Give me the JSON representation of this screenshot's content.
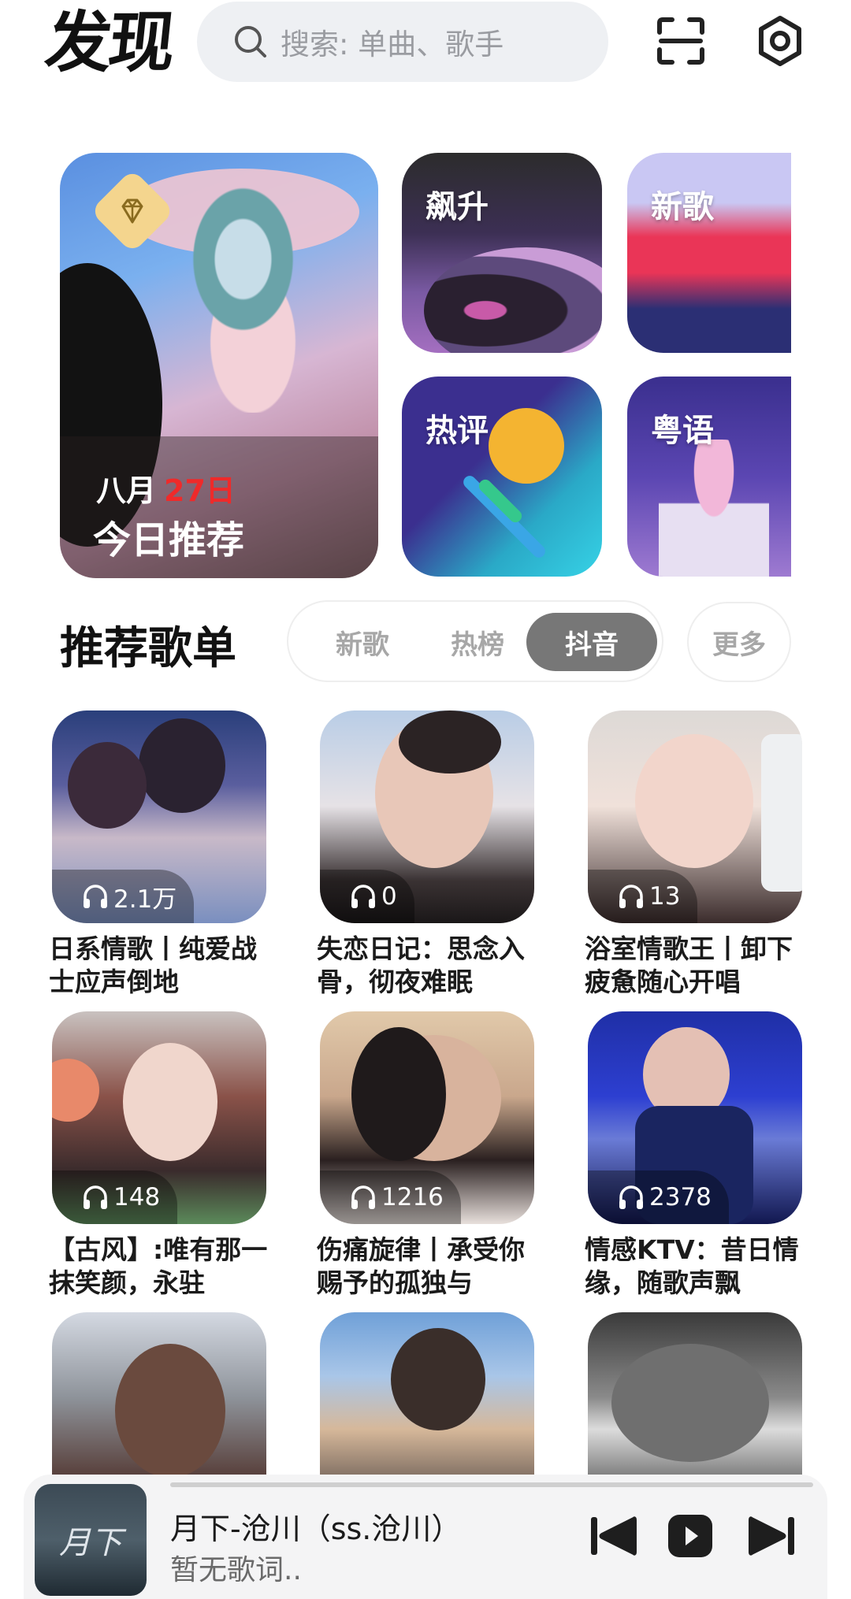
{
  "header": {
    "title": "发现",
    "search_placeholder": "搜索: 单曲、歌手",
    "icons": [
      "search-icon",
      "scan-icon",
      "settings-icon"
    ]
  },
  "banners": {
    "today": {
      "month": "八月",
      "day": "27日",
      "title": "今日推荐",
      "badge_icon": "diamond-icon"
    },
    "soar": {
      "label": "飙升"
    },
    "new": {
      "label": "新歌"
    },
    "hot_comments": {
      "label": "热评"
    },
    "cantonese": {
      "label": "粤语"
    }
  },
  "playlists_section": {
    "title": "推荐歌单",
    "tabs": [
      "新歌",
      "热榜",
      "抖音"
    ],
    "active_tab": "抖音",
    "more_label": "更多",
    "items": [
      {
        "plays": "2.1万",
        "title": "日系情歌丨纯爱战士应声倒地"
      },
      {
        "plays": "0",
        "title": "失恋日记：思念入骨，彻夜难眠"
      },
      {
        "plays": "13",
        "title": "浴室情歌王丨卸下疲惫随心开唱"
      },
      {
        "plays": "148",
        "title": "【古风】:唯有那一抹笑颜，永驻"
      },
      {
        "plays": "1216",
        "title": "伤痛旋律丨承受你赐予的孤独与"
      },
      {
        "plays": "2378",
        "title": "情感KTV：昔日情缘，随歌声飘"
      },
      {
        "plays": "",
        "title": ""
      },
      {
        "plays": "",
        "title": ""
      },
      {
        "plays": "",
        "title": ""
      }
    ]
  },
  "player": {
    "cover_text": "月下",
    "song": "月下-沧川（ss.沧川）",
    "lyric": "暂无歌词..",
    "controls": [
      "previous-icon",
      "play-icon",
      "next-icon"
    ]
  }
}
